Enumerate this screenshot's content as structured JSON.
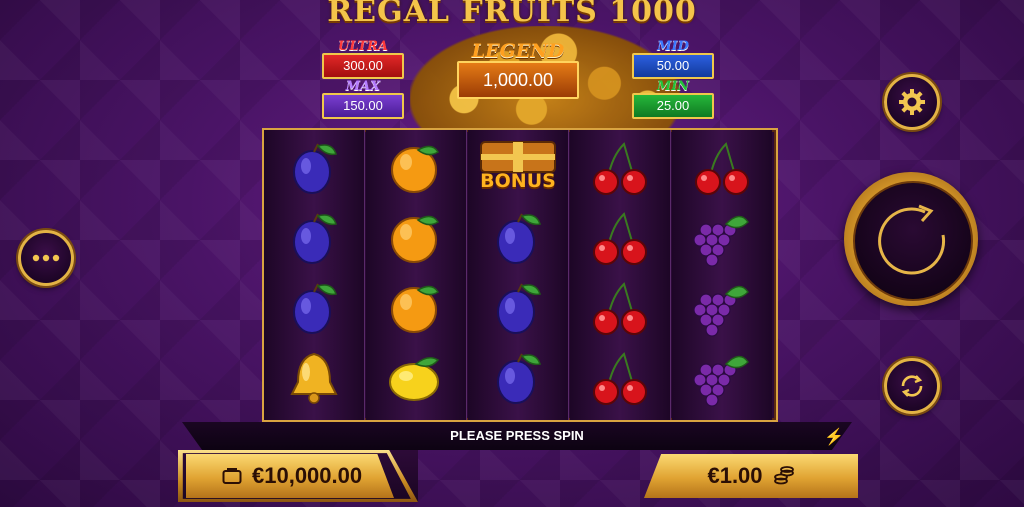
{
  "game": {
    "title": "REGAL FRUITS 1000"
  },
  "jackpots": {
    "ultra": {
      "label": "ULTRA",
      "value": "300.00"
    },
    "max": {
      "label": "MAX",
      "value": "150.00"
    },
    "legend": {
      "label": "LEGEND",
      "value": "1,000.00"
    },
    "mid": {
      "label": "MID",
      "value": "50.00"
    },
    "min": {
      "label": "MIN",
      "value": "25.00"
    }
  },
  "reels": {
    "columns": [
      [
        "plum",
        "plum",
        "plum",
        "bell"
      ],
      [
        "orange",
        "orange",
        "orange",
        "lemon"
      ],
      [
        "bonus",
        "plum",
        "plum",
        "plum"
      ],
      [
        "cherry",
        "cherry",
        "cherry",
        "cherry"
      ],
      [
        "cherry",
        "grapes",
        "grapes",
        "grapes"
      ]
    ],
    "bonus_label": "BONUS"
  },
  "status": {
    "message": "PLEASE PRESS SPIN",
    "turbo_icon": "lightning-icon"
  },
  "balance": {
    "amount": "€10,000.00",
    "icon": "wallet-icon"
  },
  "bet": {
    "amount": "€1.00",
    "icon": "coin-stack-icon"
  },
  "controls": {
    "menu_icon": "more-dots-icon",
    "settings_icon": "gear-icon",
    "spin_icon": "spin-arrow-icon",
    "autoplay_icon": "autoplay-icon"
  },
  "colors": {
    "background": "#4a1466",
    "gold": "#e3b344",
    "ultra": "#e22828",
    "max": "#7a3fd1",
    "legend": "#e57b16",
    "mid": "#2c5fe0",
    "min": "#26b73a"
  }
}
